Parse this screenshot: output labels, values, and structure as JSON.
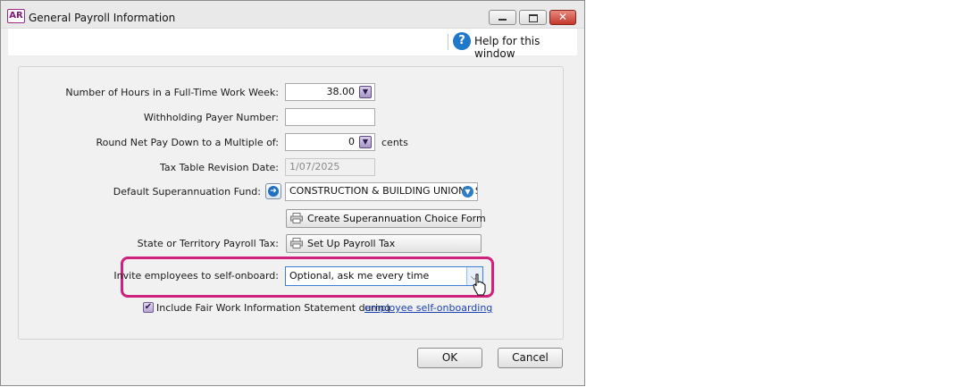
{
  "window": {
    "title": "General Payroll Information",
    "app_icon_text": "AR",
    "controls": {
      "minimize": "minimize-icon",
      "maximize": "maximize-icon",
      "close": "close-icon"
    }
  },
  "help": {
    "label": "Help for this window",
    "icon_text": "?"
  },
  "form": {
    "hours": {
      "label": "Number of Hours in a Full-Time Work Week:",
      "value": "38.00"
    },
    "payer_number": {
      "label": "Withholding Payer Number:",
      "value": ""
    },
    "round_net_pay": {
      "label": "Round Net Pay Down to a Multiple of:",
      "value": "0",
      "unit": "cents"
    },
    "tax_table": {
      "label": "Tax Table Revision Date:",
      "value": "1/07/2025"
    },
    "super_fund": {
      "label": "Default Superannuation Fund:",
      "value": "CONSTRUCTION & BUILDING UNIONS S"
    },
    "super_choice_button": "Create Superannuation Choice Form",
    "payroll_tax": {
      "label": "State or Territory Payroll Tax:",
      "button": "Set Up Payroll Tax"
    },
    "self_onboard": {
      "label": "Invite employees to self-onboard:",
      "value": "Optional, ask me every time"
    },
    "fair_work": {
      "checked": true,
      "label": "Include Fair Work Information Statement during",
      "link": "employee self-onboarding"
    }
  },
  "footer": {
    "ok": "OK",
    "cancel": "Cancel"
  },
  "colors": {
    "highlight": "#d0227d",
    "accent": "#1f78c8",
    "brand": "#7a1b74"
  }
}
